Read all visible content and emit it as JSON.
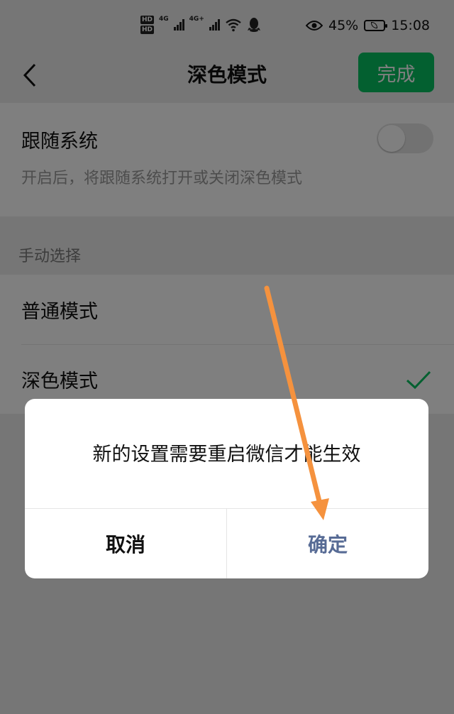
{
  "status_bar": {
    "network_labels": [
      "4G",
      "4G+"
    ],
    "battery_percent": "45%",
    "time": "15:08",
    "icons": [
      "hd-icon",
      "signal-icon",
      "wifi-icon",
      "qq-icon",
      "eye-icon",
      "battery-icon"
    ]
  },
  "nav": {
    "title": "深色模式",
    "done_label": "完成"
  },
  "follow_system": {
    "label": "跟随系统",
    "description": "开启后，将跟随系统打开或关闭深色模式",
    "enabled": false
  },
  "manual": {
    "header": "手动选择",
    "options": [
      {
        "label": "普通模式",
        "selected": false
      },
      {
        "label": "深色模式",
        "selected": true
      }
    ]
  },
  "dialog": {
    "message": "新的设置需要重启微信才能生效",
    "cancel_label": "取消",
    "confirm_label": "确定"
  },
  "colors": {
    "accent_green": "#07c160",
    "confirm_blue": "#576b95",
    "annotation_arrow": "#f5923e"
  }
}
